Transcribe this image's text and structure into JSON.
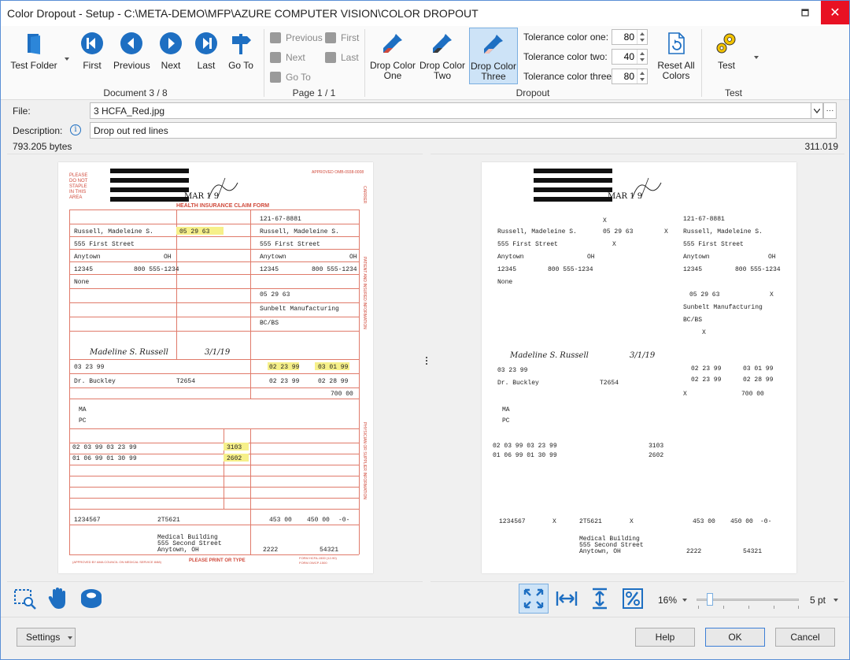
{
  "window": {
    "title": "Color Dropout - Setup - C:\\META-DEMO\\MFP\\AZURE COMPUTER VISION\\COLOR DROPOUT",
    "close_glyph": "✕",
    "restore_glyph": "❐"
  },
  "ribbon": {
    "document_group": {
      "label": "Document 3 / 8",
      "test_folder": "Test Folder",
      "first": "First",
      "previous": "Previous",
      "next": "Next",
      "last": "Last",
      "goto": "Go To"
    },
    "page_group": {
      "label": "Page 1 / 1",
      "previous": "Previous",
      "next": "Next",
      "goto": "Go To",
      "first": "First",
      "last": "Last"
    },
    "dropout_group": {
      "label": "Dropout",
      "drop_one_line1": "Drop Color",
      "drop_one_line2": "One",
      "drop_two_line1": "Drop Color",
      "drop_two_line2": "Two",
      "drop_three_line1": "Drop Color",
      "drop_three_line2": "Three",
      "tol_one_label": "Tolerance color one:",
      "tol_one_value": "80",
      "tol_two_label": "Tolerance color two:",
      "tol_two_value": "40",
      "tol_three_label": "Tolerance color three:",
      "tol_three_value": "80",
      "reset_line1": "Reset All",
      "reset_line2": "Colors"
    },
    "test_group": {
      "label": "Test",
      "test": "Test"
    }
  },
  "fields": {
    "file_label": "File:",
    "file_value": "3 HCFA_Red.jpg",
    "more_glyph": "···",
    "description_label": "Description:",
    "description_value": "Drop out red lines",
    "left_size": "793.205 bytes",
    "right_size": "311.019 bytes"
  },
  "form": {
    "header_title": "HEALTH INSURANCE CLAIM FORM",
    "please": "PLEASE",
    "do_not": "DO NOT",
    "staple": "STAPLE",
    "in_this": "IN THIS",
    "area": "AREA",
    "approved": "APPROVED OMB-0938-0008",
    "carrier": "CARRIER",
    "patient_insured": "PATIENT AND INSURED INFORMATION",
    "physician": "PHYSICIAN OR SUPPLIER INFORMATION",
    "stamp": "MAR 1 9",
    "insured_id": "121-67-8881",
    "patient_name": "Russell, Madeleine S.",
    "insured_name": "Russell, Madeleine S.",
    "patient_address": "555 First Street",
    "insured_address": "555 First Street",
    "city": "Anytown",
    "state": "OH",
    "insured_city": "Anytown",
    "insured_state": "OH",
    "zip": "12345",
    "phone": "800 555-1234",
    "insured_zip": "12345",
    "insured_phone": "800 555-1234",
    "dob": "05 29 63",
    "other_insured": "None",
    "insured_dob": "05 29 63",
    "employer": "Sunbelt Manufacturing",
    "plan": "BC/BS",
    "signature": "Madeline S. Russell",
    "sig_date": "3/1/19",
    "illness_date": "03 23 99",
    "unable_from": "02 23 99",
    "unable_to": "03 01 99",
    "hosp_from": "02 23 99",
    "hosp_to": "02 28 99",
    "referring": "Dr. Buckley",
    "referring_id": "T2654",
    "charges": "700 00",
    "dx1": "MA",
    "dx2": "PC",
    "svc1": "02  03 99  03 23  99",
    "svc2": "01  06 99  01 30  99",
    "code1": "3103",
    "code2": "2602",
    "tax_id": "1234567",
    "account": "2T5621",
    "total": "453 00",
    "paid": "450 00",
    "balance": "-0-",
    "facility1": "Medical Building",
    "facility2": "555 Second Street",
    "facility3": "Anytown, OH",
    "phone2": "2222",
    "grp": "54321",
    "x_mark": "X",
    "footer_left": "(APPROVED BY AMA COUNCIL ON MEDICAL SERVICE 8/88)",
    "footer_mid": "PLEASE PRINT OR TYPE",
    "footer_right1": "FORM HCFA-1500  (12-90)",
    "footer_right2": "FORM OWCP-1500"
  },
  "tools": {
    "zoom": "16%",
    "pt": "5 pt"
  },
  "footer": {
    "settings": "Settings",
    "help": "Help",
    "ok": "OK",
    "cancel": "Cancel"
  }
}
